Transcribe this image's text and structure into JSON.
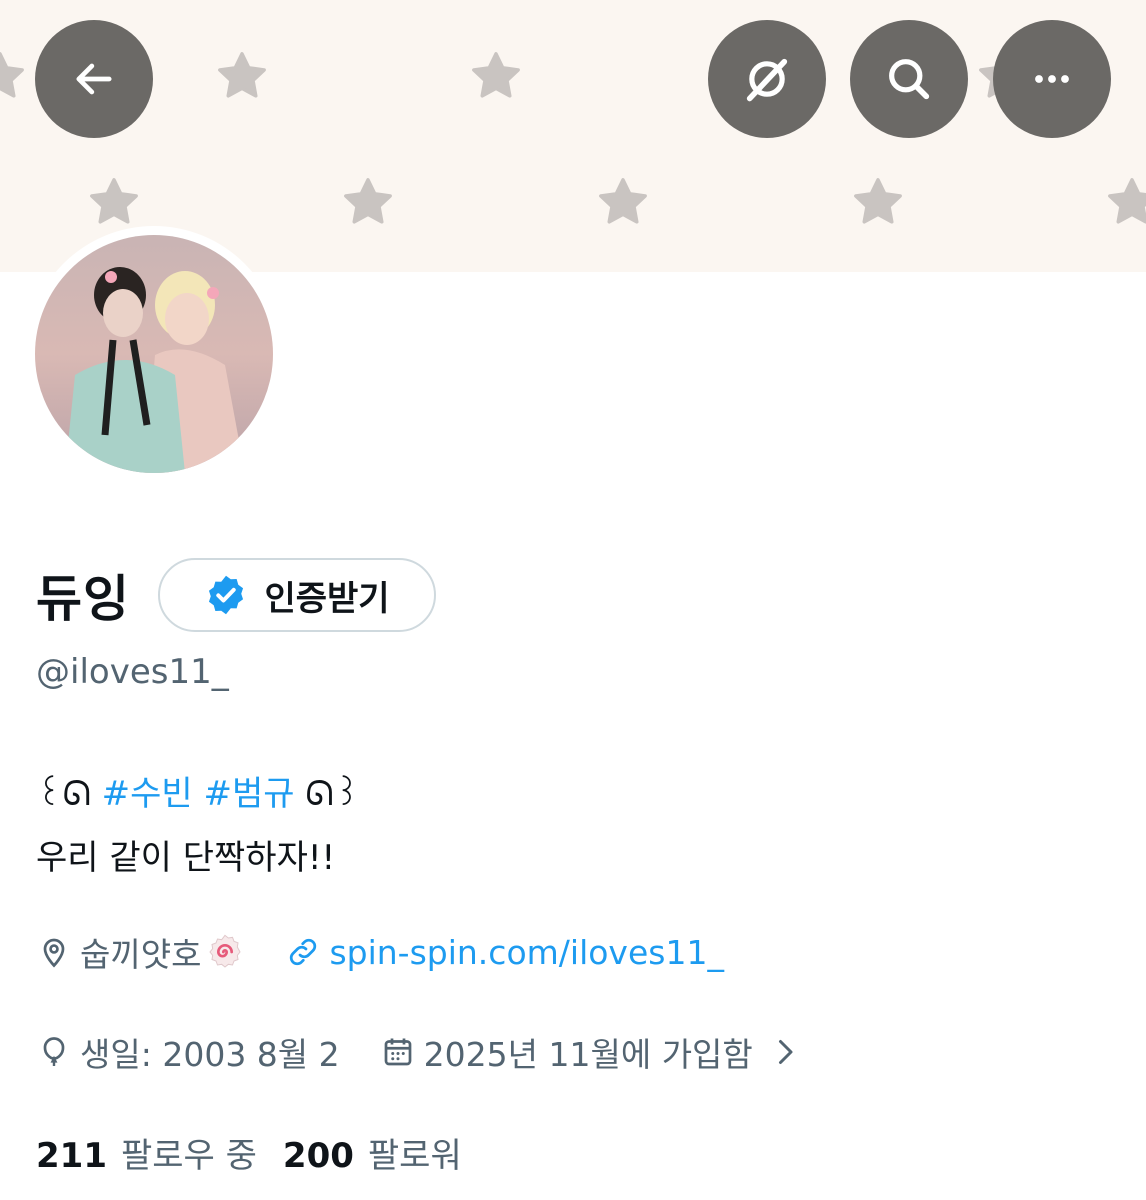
{
  "header": {
    "back_icon": "arrow-left-icon",
    "icons": [
      "grok-icon",
      "search-icon",
      "more-icon"
    ]
  },
  "profile": {
    "display_name": "듀잉",
    "verify_label": "인증받기",
    "handle": "@iloves11_",
    "bio": {
      "open_deco": "꒰ᘏ",
      "hashtag1": "#수빈",
      "hashtag2": "#범규",
      "close_deco": "ᘏ꒱",
      "line2": "우리 같이 단짝하자!!"
    },
    "location": "숩끼얏호",
    "website": "spin-spin.com/iloves11_",
    "birthday": "생일: 2003 8월 2",
    "joined": "2025년 11월에 가입함",
    "following_count": "211",
    "following_label": "팔로우 중",
    "followers_count": "200",
    "followers_label": "팔로워"
  },
  "colors": {
    "accent": "#1d9bf0",
    "banner": "#fbf6f1",
    "star": "#c9c4c1",
    "header_button": "#6b6966",
    "secondary_text": "#536471"
  }
}
